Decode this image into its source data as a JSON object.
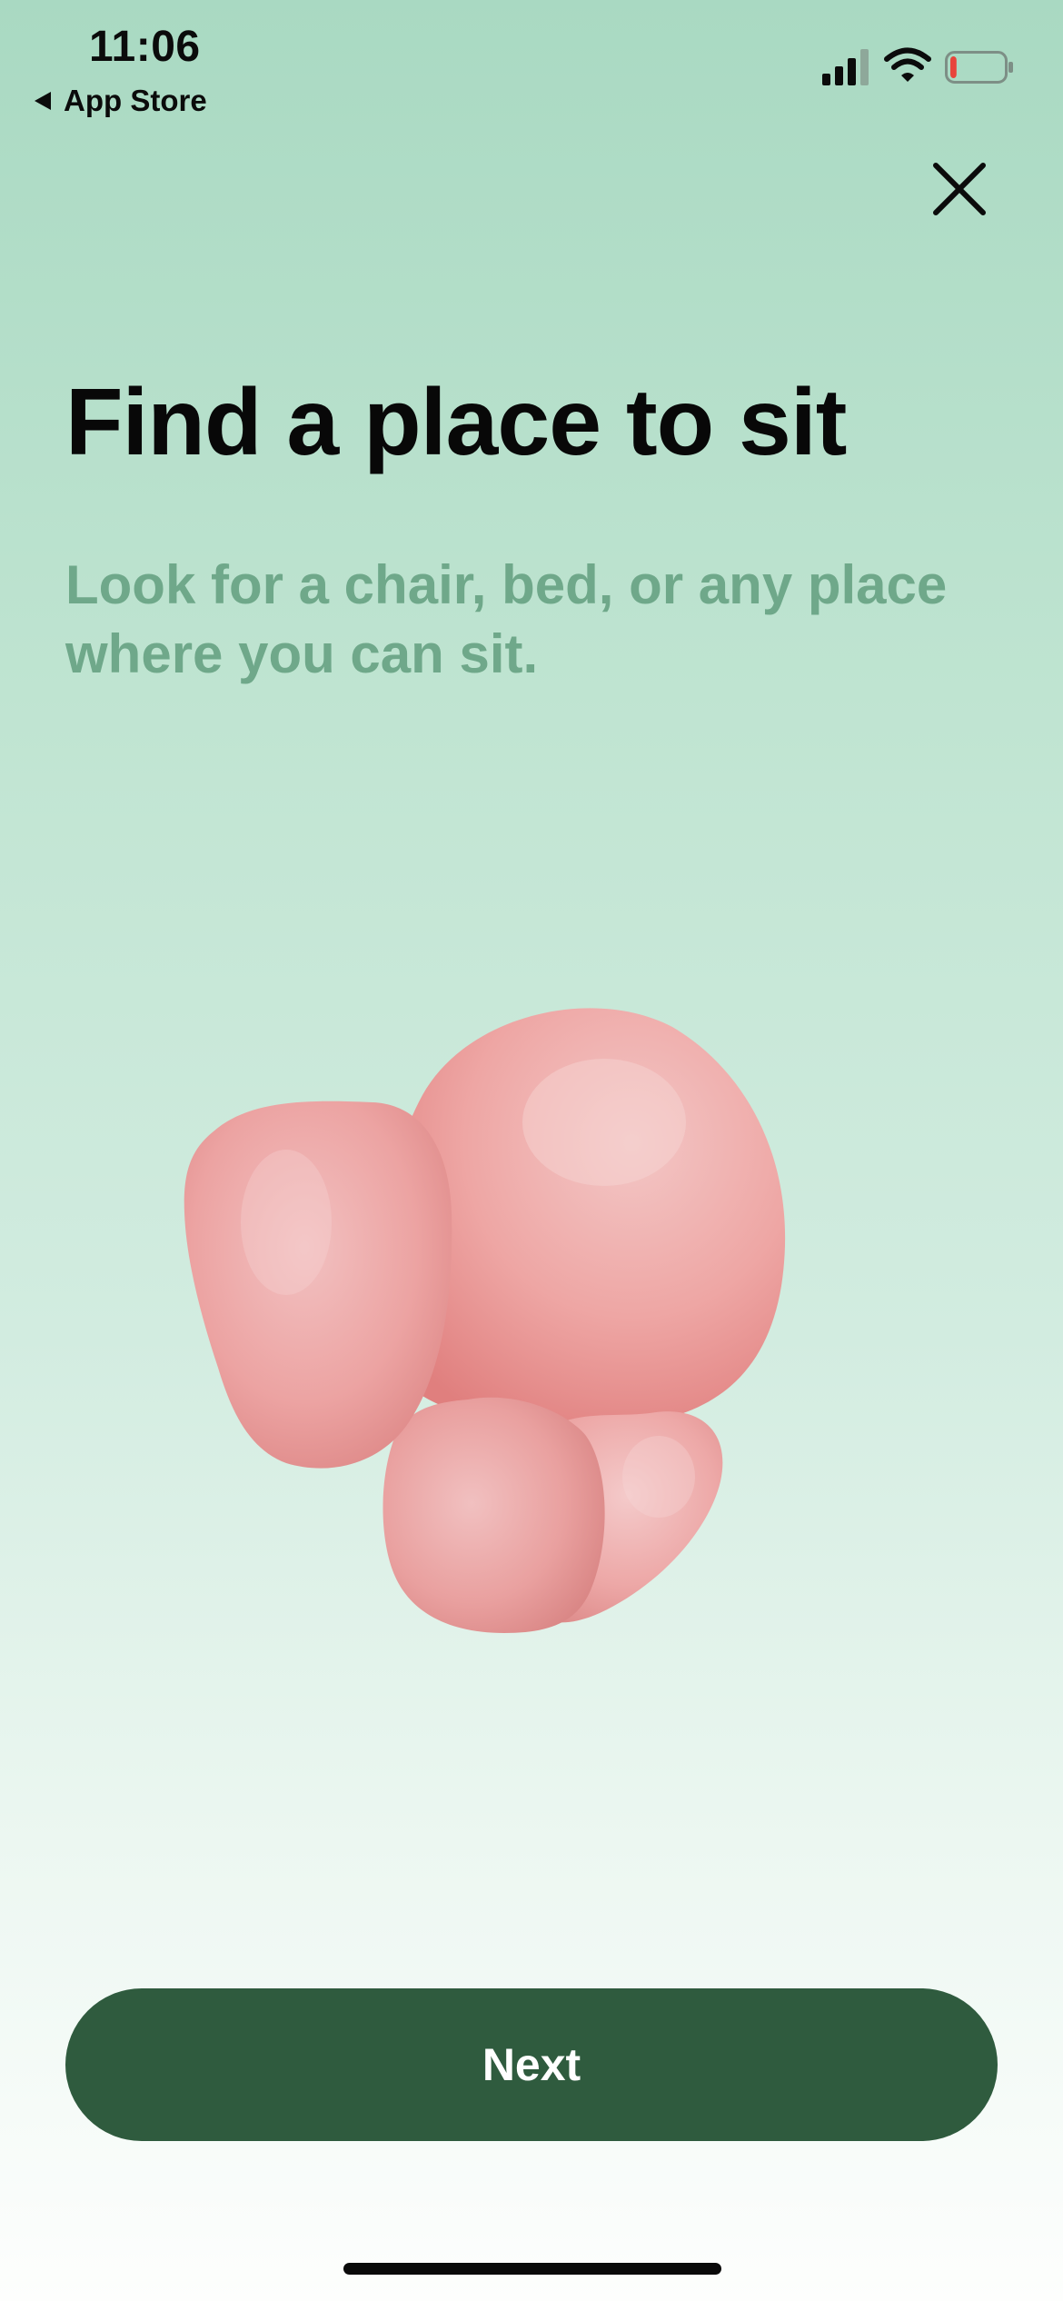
{
  "status_bar": {
    "time": "11:06",
    "back_label": "App Store",
    "battery_level": 0.12,
    "icons": [
      "cellular-signal-icon",
      "wifi-icon",
      "battery-icon"
    ]
  },
  "header": {
    "close_icon": "close-icon"
  },
  "content": {
    "title": "Find a place to sit",
    "subtitle": "Look for a chair, bed, or any place where you can sit."
  },
  "illustration": {
    "name": "pink-clay-blob-illustration",
    "color": "#ee9f9d"
  },
  "footer": {
    "next_label": "Next"
  },
  "colors": {
    "background_top": "#a9d9c2",
    "background_bottom": "#fdfefd",
    "title": "#080808",
    "subtitle": "#6fa88a",
    "primary_button": "#2f5b3e",
    "button_text": "#ffffff"
  }
}
